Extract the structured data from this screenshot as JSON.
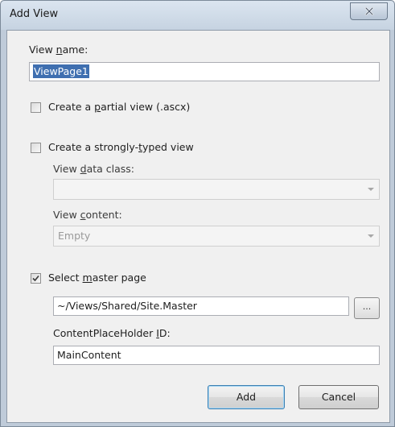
{
  "window": {
    "title": "Add View"
  },
  "view_name": {
    "label_pre": "View ",
    "label_key": "n",
    "label_post": "ame:",
    "value": "ViewPage1"
  },
  "partial_view": {
    "label_pre": "Create a ",
    "label_key": "p",
    "label_post": "artial view (.ascx)",
    "checked": false
  },
  "strongly_typed": {
    "label_pre": "Create a strongly-",
    "label_key": "t",
    "label_post": "yped view",
    "checked": false
  },
  "view_data_class": {
    "label_pre": "View ",
    "label_key": "d",
    "label_post": "ata class:",
    "value": ""
  },
  "view_content": {
    "label_pre": "View ",
    "label_key": "c",
    "label_post": "ontent:",
    "value": "Empty"
  },
  "master_page": {
    "label_pre": "Select ",
    "label_key": "m",
    "label_post": "aster page",
    "checked": true,
    "path": "~/Views/Shared/Site.Master",
    "browse_label": "..."
  },
  "content_placeholder": {
    "label_pre": "ContentPlaceHolder ",
    "label_key": "I",
    "label_post": "D:",
    "value": "MainContent"
  },
  "buttons": {
    "add": "Add",
    "cancel": "Cancel"
  },
  "icons": {
    "close": "close-icon",
    "checkmark": "checkmark-icon",
    "dropdown": "chevron-down-icon"
  }
}
